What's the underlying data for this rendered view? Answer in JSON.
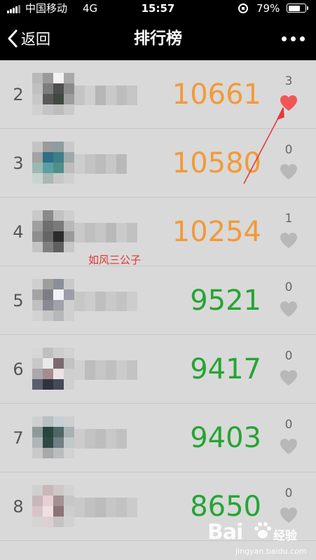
{
  "status_bar": {
    "carrier": "中国移动",
    "network": "4G",
    "time": "15:57",
    "battery": "79%",
    "battery_level": 0.79
  },
  "nav": {
    "back_label": "返回",
    "title": "排行榜",
    "more_icon": "more-dots-icon"
  },
  "colors": {
    "top_score": "#f29a38",
    "other_score": "#25a533",
    "heart_liked": "#f25555",
    "heart_default": "#b8b8b8",
    "background": "#d9d9d9"
  },
  "rows": [
    {
      "rank": "2",
      "score": "10661",
      "likes": "3",
      "liked": true
    },
    {
      "rank": "3",
      "score": "10580",
      "likes": "0",
      "liked": false
    },
    {
      "rank": "4",
      "score": "10254",
      "likes": "1",
      "liked": false
    },
    {
      "rank": "5",
      "score": "9521",
      "likes": "0",
      "liked": false
    },
    {
      "rank": "6",
      "score": "9417",
      "likes": "0",
      "liked": false
    },
    {
      "rank": "7",
      "score": "9403",
      "likes": "0",
      "liked": false
    },
    {
      "rank": "8",
      "score": "8650",
      "likes": "0",
      "liked": false
    }
  ],
  "annotation_text": "如风三公子",
  "watermark": {
    "logo": "Bai",
    "name": "经验",
    "url": "jingyan.baidu.com"
  }
}
